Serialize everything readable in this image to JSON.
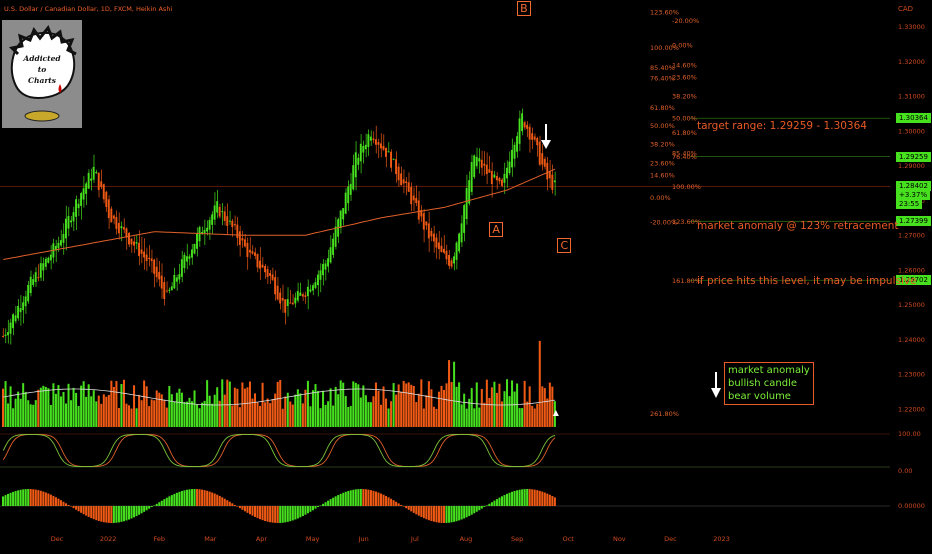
{
  "header": {
    "title": "U.S. Dollar / Canadian Dollar, 1D, FXCM, Heikin Ashi",
    "currency": "CAD"
  },
  "logo": {
    "line1": "Addicted",
    "line2": "to",
    "line3": "Charts"
  },
  "colors": {
    "up": "#46e01e",
    "down": "#f05a14",
    "ma": "#e0602a",
    "accent": "#e85a26",
    "label_green": "#7cf03a"
  },
  "chart_data": [
    {
      "type": "candlestick",
      "title": "U.S. Dollar / Canadian Dollar, 1D, FXCM, Heikin Ashi",
      "style": "heikin-ashi",
      "ylim": [
        1.2148,
        1.3368
      ],
      "y_ticks": [
        "1.33000",
        "1.32000",
        "1.31000",
        "1.30000",
        "1.29000",
        "1.28000",
        "1.27000",
        "1.26000",
        "1.25000",
        "1.24000",
        "1.23000",
        "1.22000"
      ],
      "x_ticks": [
        "Dec",
        "2022",
        "Feb",
        "Mar",
        "Apr",
        "May",
        "Jun",
        "Jul",
        "Aug",
        "Sep",
        "Oct",
        "Nov",
        "Dec",
        "2023"
      ],
      "bars_per_month": 21,
      "start": "2021-11-01",
      "waypoints": [
        [
          0,
          1.241
        ],
        [
          10,
          1.255
        ],
        [
          22,
          1.268
        ],
        [
          30,
          1.281
        ],
        [
          36,
          1.289
        ],
        [
          42,
          1.276
        ],
        [
          50,
          1.269
        ],
        [
          58,
          1.262
        ],
        [
          65,
          1.252
        ],
        [
          72,
          1.263
        ],
        [
          79,
          1.272
        ],
        [
          85,
          1.278
        ],
        [
          92,
          1.271
        ],
        [
          98,
          1.264
        ],
        [
          106,
          1.258
        ],
        [
          112,
          1.249
        ],
        [
          120,
          1.254
        ],
        [
          128,
          1.262
        ],
        [
          134,
          1.276
        ],
        [
          140,
          1.292
        ],
        [
          146,
          1.3
        ],
        [
          152,
          1.294
        ],
        [
          158,
          1.286
        ],
        [
          163,
          1.279
        ],
        [
          168,
          1.271
        ],
        [
          173,
          1.265
        ],
        [
          178,
          1.262
        ],
        [
          182,
          1.275
        ],
        [
          187,
          1.293
        ],
        [
          192,
          1.288
        ],
        [
          198,
          1.283
        ],
        [
          202,
          1.296
        ],
        [
          206,
          1.304
        ],
        [
          210,
          1.298
        ],
        [
          213,
          1.292
        ],
        [
          216,
          1.286
        ],
        [
          219,
          1.284
        ]
      ],
      "ma_waypoints": [
        [
          0,
          1.263
        ],
        [
          30,
          1.267
        ],
        [
          60,
          1.271
        ],
        [
          95,
          1.27
        ],
        [
          120,
          1.27
        ],
        [
          150,
          1.275
        ],
        [
          175,
          1.278
        ],
        [
          200,
          1.283
        ],
        [
          219,
          1.289
        ]
      ],
      "last_price": "1.28402",
      "change_pct": "+3.37%",
      "countdown": "23:55",
      "price_labels": [
        {
          "value": 1.30364,
          "text": "1.30364",
          "style": "green"
        },
        {
          "value": 1.29259,
          "text": "1.29259",
          "style": "green"
        },
        {
          "value": 1.28402,
          "text": "1.28402",
          "style": "green"
        },
        {
          "value": 1.27399,
          "text": "1.27399",
          "style": "green"
        },
        {
          "value": 1.25702,
          "text": "1.25702",
          "style": "green"
        }
      ],
      "horizontal_levels": [
        {
          "value": 1.30364,
          "label": "50.00%",
          "style": "green"
        },
        {
          "value": 1.29259,
          "label": "76.40%",
          "style": "green"
        },
        {
          "value": 1.28402,
          "label": "100.00%",
          "style": "red"
        },
        {
          "value": 1.27399,
          "label": "123.60%",
          "style": "green"
        },
        {
          "value": 1.25702,
          "label": "161.80%",
          "style": "green"
        },
        {
          "value": 1.2187,
          "label": "261.80%",
          "style": "none"
        }
      ],
      "fib_secondary": [
        {
          "value": 1.3318,
          "label": "-20.00%"
        },
        {
          "value": 1.3247,
          "label": "0.00%"
        },
        {
          "value": 1.319,
          "label": "14.60%"
        },
        {
          "value": 1.3155,
          "label": "23.60%"
        },
        {
          "value": 1.31,
          "label": "38.20%"
        },
        {
          "value": 1.2995,
          "label": "61.80%"
        },
        {
          "value": 1.2937,
          "label": "85.40%"
        }
      ],
      "fib_primary": [
        {
          "value": 1.3342,
          "label": "123.60%"
        },
        {
          "value": 1.324,
          "label": "100.00%"
        },
        {
          "value": 1.3183,
          "label": "85.40%"
        },
        {
          "value": 1.3152,
          "label": "76.40%"
        },
        {
          "value": 1.3068,
          "label": "61.80%"
        },
        {
          "value": 1.3015,
          "label": "50.00%"
        },
        {
          "value": 1.2963,
          "label": "38.20%"
        },
        {
          "value": 1.2908,
          "label": "23.60%"
        },
        {
          "value": 1.2873,
          "label": "14.60%"
        },
        {
          "value": 1.2808,
          "label": "0.00%"
        },
        {
          "value": 1.2738,
          "label": "-20.00%"
        }
      ],
      "wave_labels": [
        {
          "text": "B",
          "bar": 206,
          "price": 1.3355
        },
        {
          "text": "A",
          "bar": 195,
          "price": 1.2718
        },
        {
          "text": "C",
          "bar": 222,
          "price": 1.2672
        }
      ]
    },
    {
      "type": "bar",
      "title": "Volume",
      "ma": true
    },
    {
      "type": "line",
      "title": "Stochastic",
      "y_ticks": [
        "100.00",
        "0.00"
      ],
      "ylim": [
        0,
        100
      ]
    },
    {
      "type": "bar",
      "title": "Momentum histogram",
      "y_ticks": [
        "0.00000"
      ]
    }
  ],
  "annotations": {
    "target_range": "target range: 1.29259 - 1.30364",
    "market_anomaly": "market anomaly @ 123% retracement",
    "impulsive": "if price hits this level, it may be impulsive",
    "box_line1": "market anomaly",
    "box_line2": "bullish candle",
    "box_line3": "bear volume"
  }
}
